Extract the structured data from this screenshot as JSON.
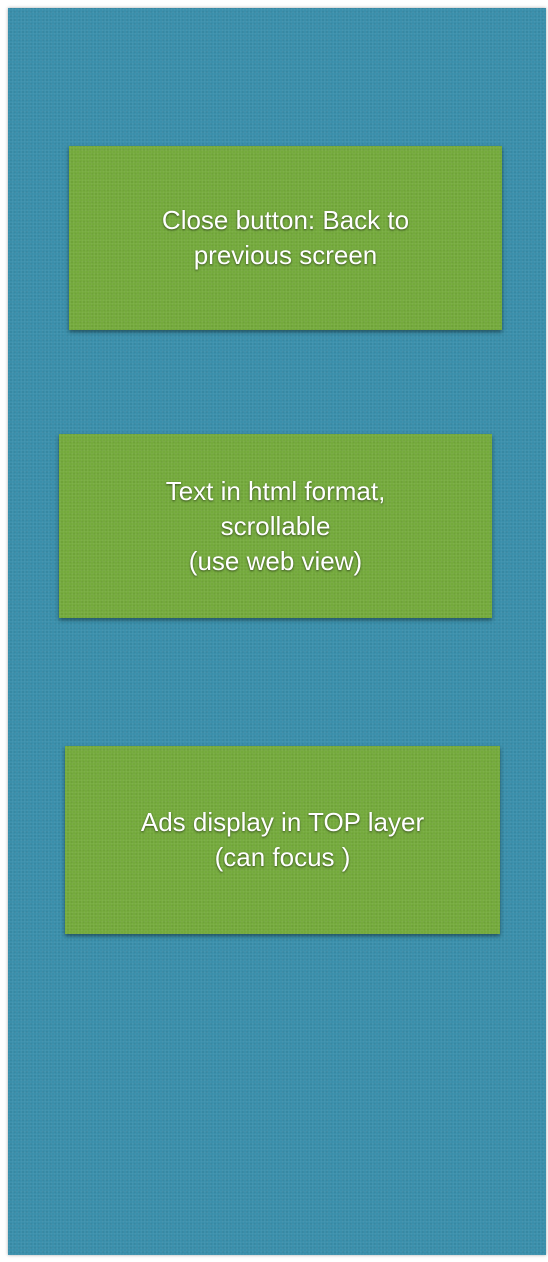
{
  "cards": [
    {
      "lines": [
        "Close button: Back to",
        "previous screen"
      ]
    },
    {
      "lines": [
        "Text in html format,",
        "scrollable",
        "(use web view)"
      ]
    },
    {
      "lines": [
        "Ads display in TOP layer",
        "(can focus )"
      ]
    }
  ],
  "colors": {
    "background": "#3a8fab",
    "card": "#74aa3c",
    "text": "#ffffff"
  }
}
